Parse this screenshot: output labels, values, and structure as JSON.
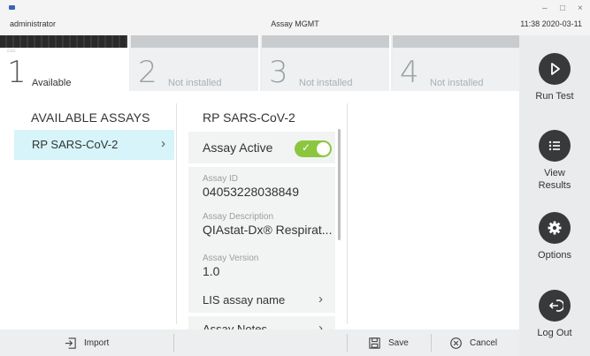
{
  "window": {
    "user": "administrator",
    "title": "Assay MGMT",
    "datetime": "11:38 2020-03-11",
    "controls": [
      "–",
      "□",
      "×"
    ]
  },
  "modules": [
    {
      "number": "1",
      "status": "Available"
    },
    {
      "number": "2",
      "status": "Not installed"
    },
    {
      "number": "3",
      "status": "Not installed"
    },
    {
      "number": "4",
      "status": "Not installed"
    }
  ],
  "sidebar": {
    "run_test": "Run Test",
    "view_results_line1": "View",
    "view_results_line2": "Results",
    "options": "Options",
    "log_out": "Log Out"
  },
  "assays": {
    "heading": "AVAILABLE ASSAYS",
    "items": [
      {
        "label": "RP SARS-CoV-2",
        "selected": true
      }
    ]
  },
  "details": {
    "title": "RP SARS-CoV-2",
    "assay_active_label": "Assay Active",
    "assay_active": true,
    "assay_id_label": "Assay ID",
    "assay_id": "04053228038849",
    "assay_description_label": "Assay Description",
    "assay_description": "QIAstat-Dx® Respirat...",
    "assay_version_label": "Assay Version",
    "assay_version": "1.0",
    "lis_assay_name": "LIS assay name",
    "assay_notes": "Assay Notes"
  },
  "bottombar": {
    "import": "Import",
    "save": "Save",
    "cancel": "Cancel"
  },
  "colors": {
    "selection_bg": "#d6f4f9",
    "toggle_on": "#8cc63f",
    "sidebar_button": "#37393b"
  }
}
